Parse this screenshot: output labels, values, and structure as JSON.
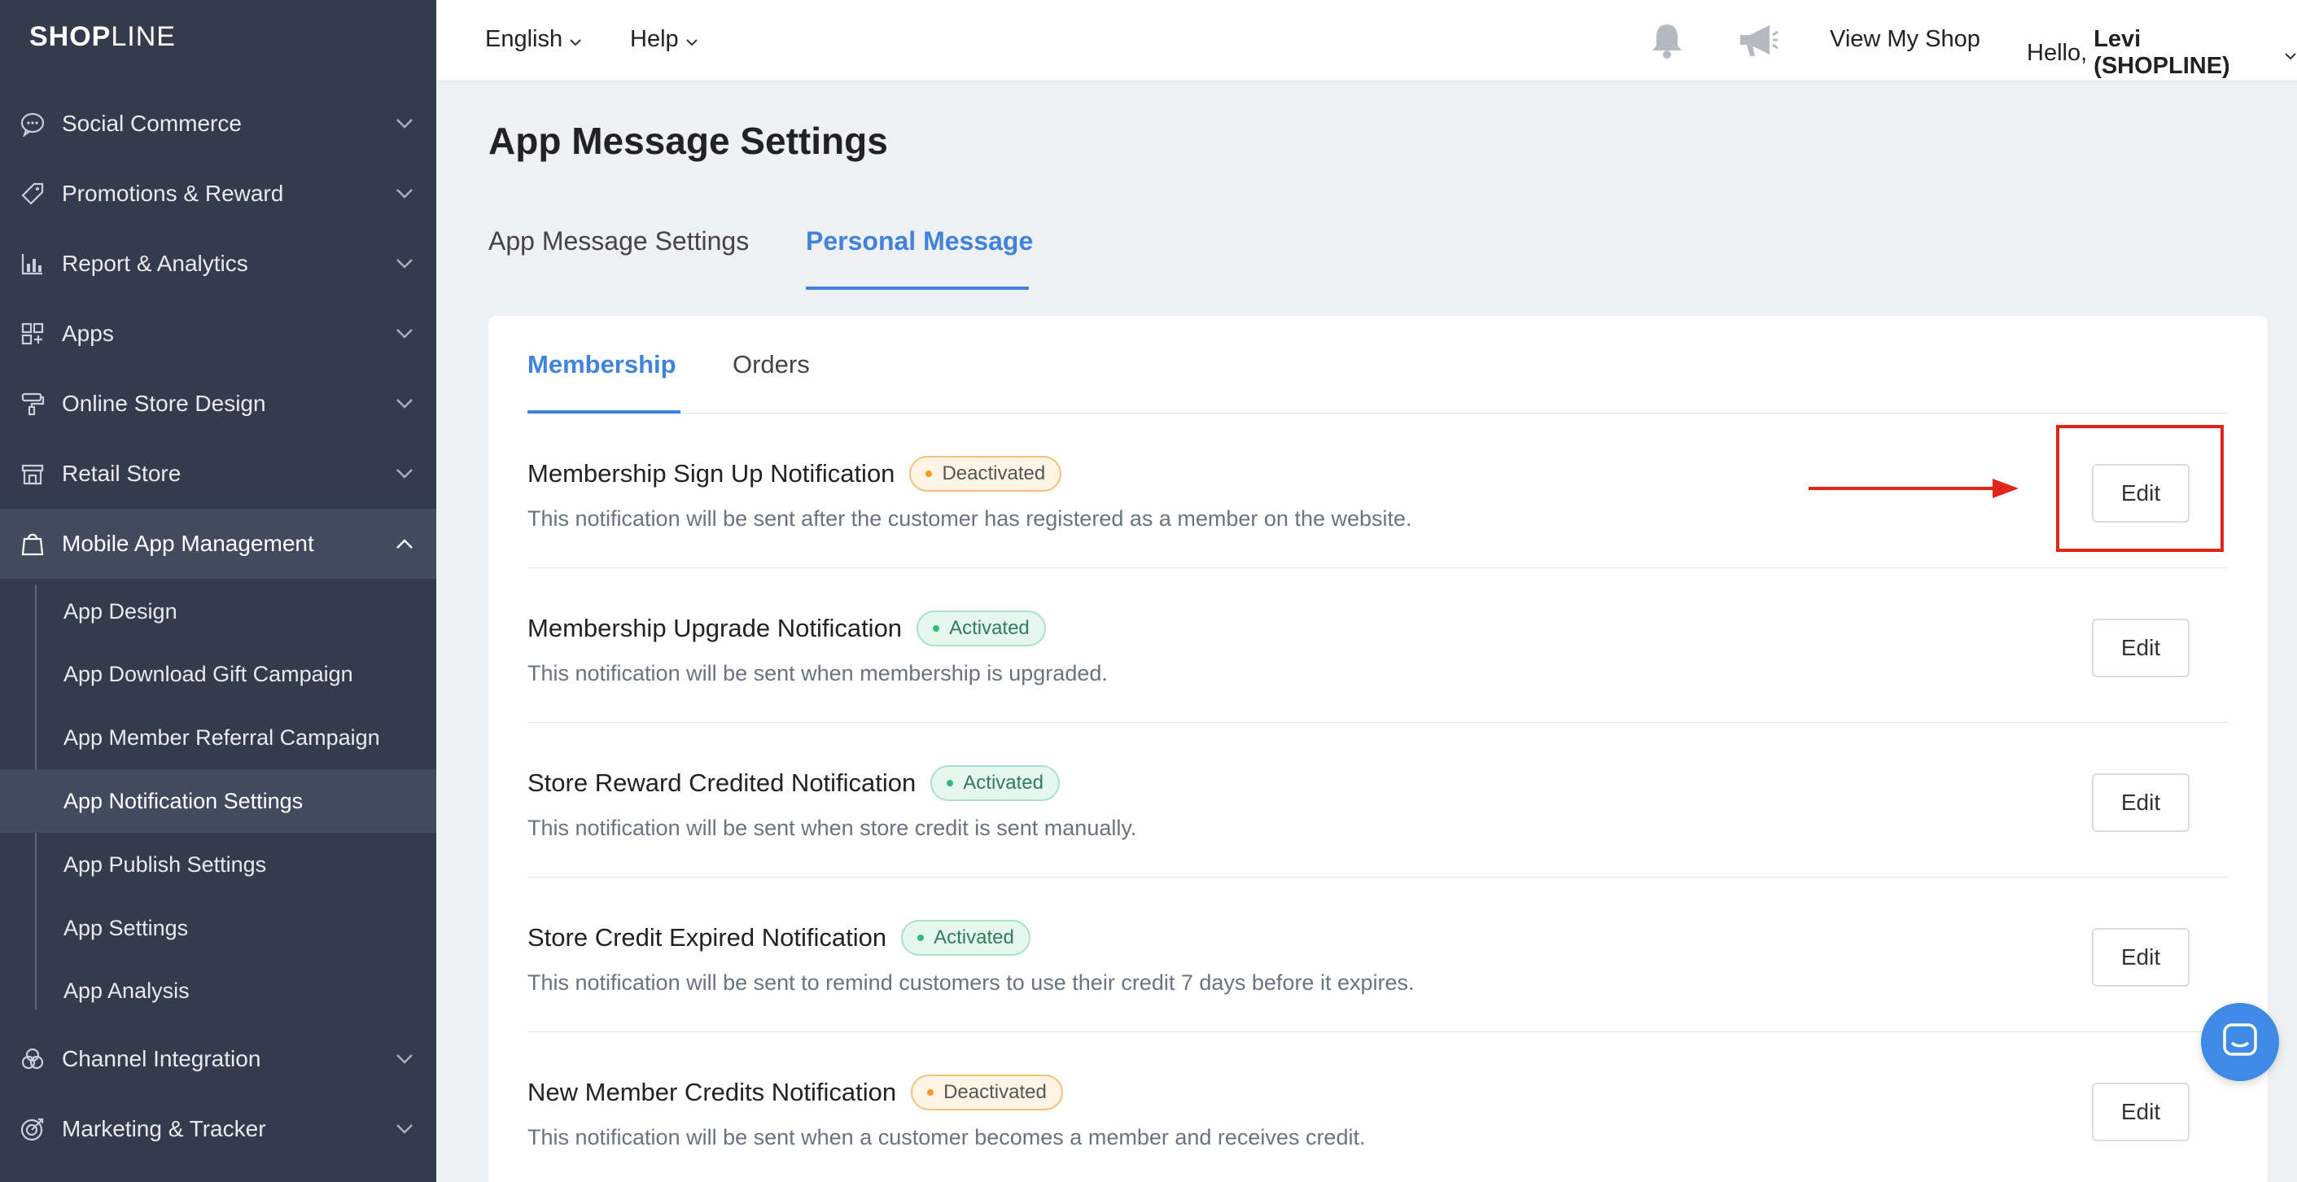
{
  "brand": {
    "logo_bold": "SHOP",
    "logo_thin": "LINE"
  },
  "sidebar": {
    "items": [
      {
        "label": "Social Commerce",
        "icon": "chat-bubble-icon"
      },
      {
        "label": "Promotions & Reward",
        "icon": "tag-icon"
      },
      {
        "label": "Report & Analytics",
        "icon": "bar-chart-icon"
      },
      {
        "label": "Apps",
        "icon": "apps-grid-icon"
      },
      {
        "label": "Online Store Design",
        "icon": "paint-roller-icon"
      },
      {
        "label": "Retail Store",
        "icon": "store-icon"
      },
      {
        "label": "Mobile App Management",
        "icon": "shopping-bag-icon"
      },
      {
        "label": "Channel Integration",
        "icon": "circles-icon"
      },
      {
        "label": "Marketing & Tracker",
        "icon": "target-icon"
      }
    ],
    "sub_items": [
      {
        "label": "App Design"
      },
      {
        "label": "App Download Gift Campaign"
      },
      {
        "label": "App Member Referral Campaign"
      },
      {
        "label": "App Notification Settings"
      },
      {
        "label": "App Publish Settings"
      },
      {
        "label": "App Settings"
      },
      {
        "label": "App Analysis"
      }
    ]
  },
  "topbar": {
    "language": "English",
    "help": "Help",
    "view_shop": "View My Shop",
    "hello_prefix": "Hello, ",
    "user": "Levi (SHOPLINE)"
  },
  "page": {
    "title": "App Message Settings",
    "tabs": [
      {
        "label": "App Message Settings"
      },
      {
        "label": "Personal Message"
      }
    ],
    "subtabs": [
      {
        "label": "Membership"
      },
      {
        "label": "Orders"
      }
    ],
    "notifications": [
      {
        "title": "Membership Sign Up Notification",
        "status": "Deactivated",
        "desc": "This notification will be sent after the customer has registered as a member on the website.",
        "action": "Edit"
      },
      {
        "title": "Membership Upgrade Notification",
        "status": "Activated",
        "desc": "This notification will be sent when membership is upgraded.",
        "action": "Edit"
      },
      {
        "title": "Store Reward Credited Notification",
        "status": "Activated",
        "desc": "This notification will be sent when store credit is sent manually.",
        "action": "Edit"
      },
      {
        "title": "Store Credit Expired Notification",
        "status": "Activated",
        "desc": "This notification will be sent to remind customers to use their credit 7 days before it expires.",
        "action": "Edit"
      },
      {
        "title": "New Member Credits Notification",
        "status": "Deactivated",
        "desc": "This notification will be sent when a customer becomes a member and receives credit.",
        "action": "Edit"
      }
    ]
  },
  "colors": {
    "accent": "#3f83dd",
    "sidebar": "#343b4c",
    "highlight": "#e0261b"
  }
}
